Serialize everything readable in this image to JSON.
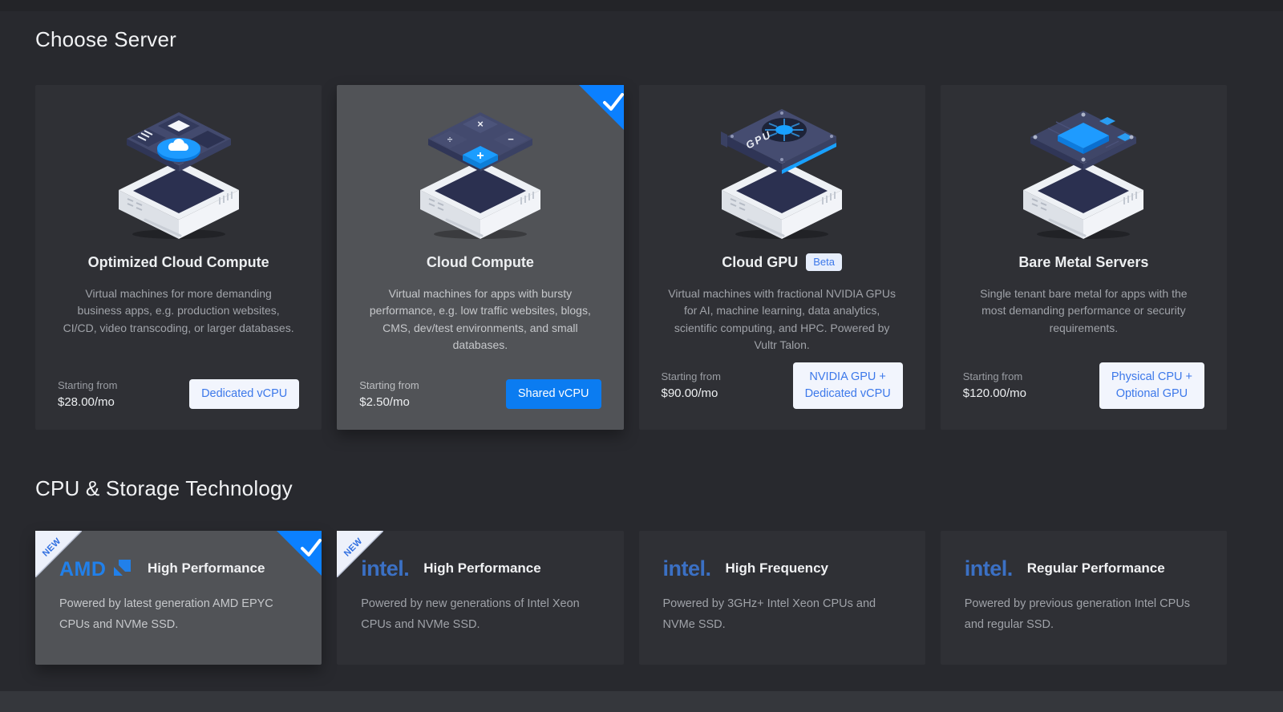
{
  "colors": {
    "page_bg": "#28292e",
    "card_bg": "#2f3035",
    "selected_card_bg": "#515357",
    "accent_blue": "#007bfc",
    "button_text_blue": "#3c78ea",
    "light_button_bg": "#f2f5fd",
    "amd_blue": "#2180ea",
    "intel_blue": "#3b70c4"
  },
  "server_section": {
    "title": "Choose Server",
    "cards": [
      {
        "title": "Optimized Cloud Compute",
        "description": "Virtual machines for more demanding business apps, e.g. production websites, CI/CD, video transcoding, or larger databases.",
        "starting_label": "Starting from",
        "price": "$28.00/mo",
        "button_line1": "Dedicated vCPU",
        "button_line2": ""
      },
      {
        "title": "Cloud Compute",
        "description": "Virtual machines for apps with bursty performance, e.g. low traffic websites, blogs, CMS, dev/test environments, and small databases.",
        "starting_label": "Starting from",
        "price": "$2.50/mo",
        "button_line1": "Shared vCPU",
        "button_line2": "",
        "selected": true
      },
      {
        "title": "Cloud GPU",
        "badge": "Beta",
        "description": "Virtual machines with fractional NVIDIA GPUs for AI, machine learning, data analytics, scientific computing, and HPC. Powered by Vultr Talon.",
        "starting_label": "Starting from",
        "price": "$90.00/mo",
        "button_line1": "NVIDIA GPU +",
        "button_line2": "Dedicated vCPU"
      },
      {
        "title": "Bare Metal Servers",
        "description": "Single tenant bare metal for apps with the most demanding performance or security requirements.",
        "starting_label": "Starting from",
        "price": "$120.00/mo",
        "button_line1": "Physical CPU +",
        "button_line2": "Optional GPU"
      }
    ]
  },
  "cpu_section": {
    "title": "CPU & Storage Technology",
    "ribbon_label": "NEW",
    "cards": [
      {
        "brand": "AMD",
        "title": "High Performance",
        "description": "Powered by latest generation AMD EPYC CPUs and NVMe SSD.",
        "new": true,
        "selected": true
      },
      {
        "brand": "intel.",
        "title": "High Performance",
        "description": "Powered by new generations of Intel Xeon CPUs and NVMe SSD.",
        "new": true
      },
      {
        "brand": "intel.",
        "title": "High Frequency",
        "description": "Powered by 3GHz+ Intel Xeon CPUs and NVMe SSD."
      },
      {
        "brand": "intel.",
        "title": "Regular Performance",
        "description": "Powered by previous generation Intel CPUs and regular SSD."
      }
    ]
  },
  "illustrations": {
    "gpu_label": "GPU"
  }
}
